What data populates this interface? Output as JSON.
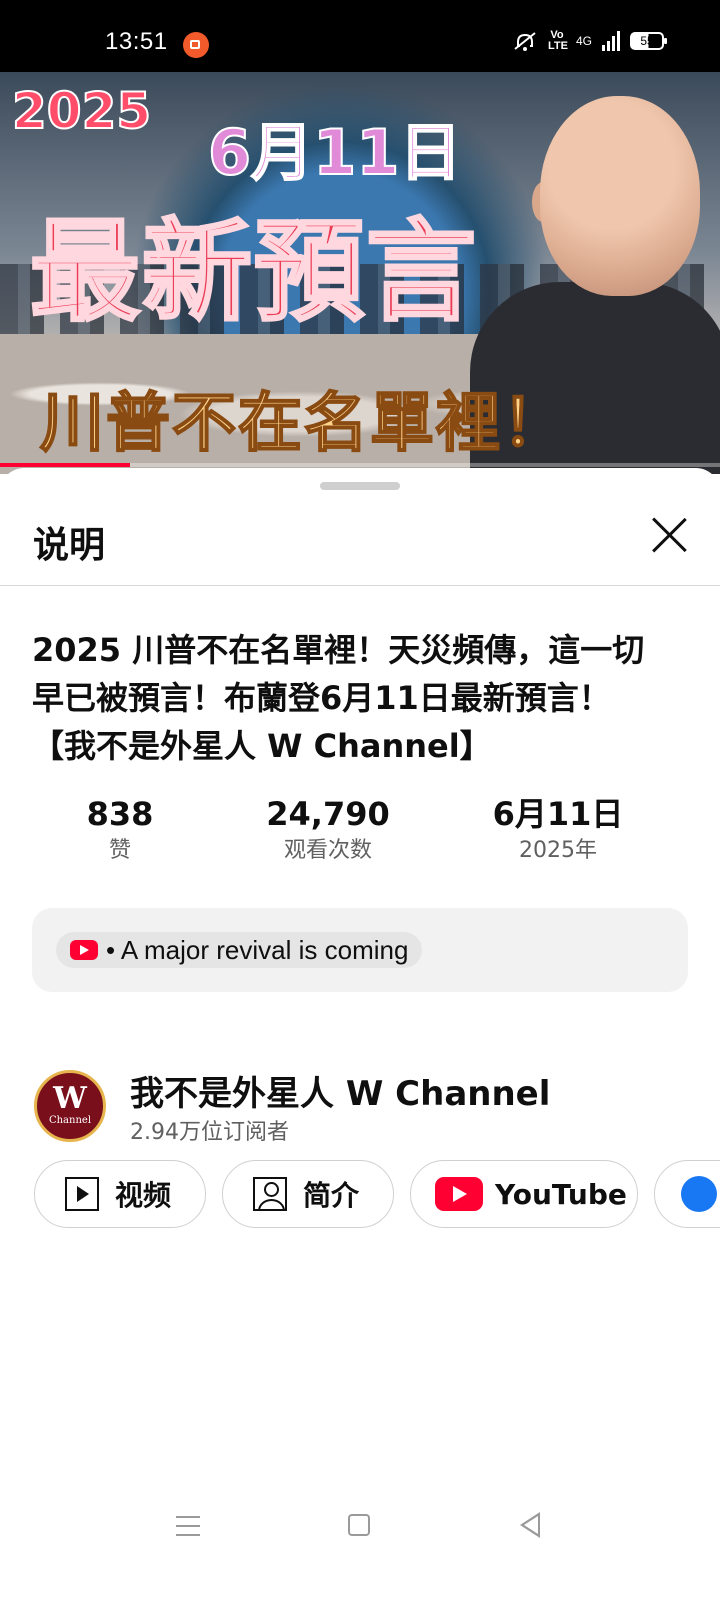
{
  "status_bar": {
    "time": "13:51",
    "network": "4G",
    "lte": "Vo LTE",
    "battery": "55",
    "icons": [
      "screen-record-icon",
      "mute-icon",
      "signal-icon",
      "battery-icon"
    ]
  },
  "video": {
    "overlay_year": "2025",
    "overlay_date": "6月11日",
    "overlay_headline": "最新預言",
    "overlay_sub": "川普不在名單裡！",
    "progress_fraction": 0.18,
    "progress_color": "#ff0033"
  },
  "sheet": {
    "title": "说明",
    "video_title": "2025 川普不在名單裡！天災頻傳，這一切早已被預言！布蘭登6月11日最新預言！【我不是外星人 W Channel】",
    "stats": [
      {
        "value": "838",
        "label": "赞"
      },
      {
        "value": "24,790",
        "label": "观看次数"
      },
      {
        "value": "6月11日",
        "label": "2025年"
      }
    ],
    "music_chip": "• A major revival is coming",
    "channel": {
      "name": "我不是外星人 W Channel",
      "subscribers": "2.94万位订阅者",
      "avatar_letter": "W",
      "avatar_sub": "Channel"
    },
    "links": [
      {
        "label": "视频",
        "icon": "video-icon"
      },
      {
        "label": "简介",
        "icon": "person-icon"
      },
      {
        "label": "YouTube",
        "icon": "youtube-icon"
      },
      {
        "label": "",
        "icon": "facebook-icon"
      }
    ]
  },
  "colors": {
    "accent": "#ff0033",
    "chip_bg": "#f2f2f2",
    "secondary_text": "#606060"
  }
}
